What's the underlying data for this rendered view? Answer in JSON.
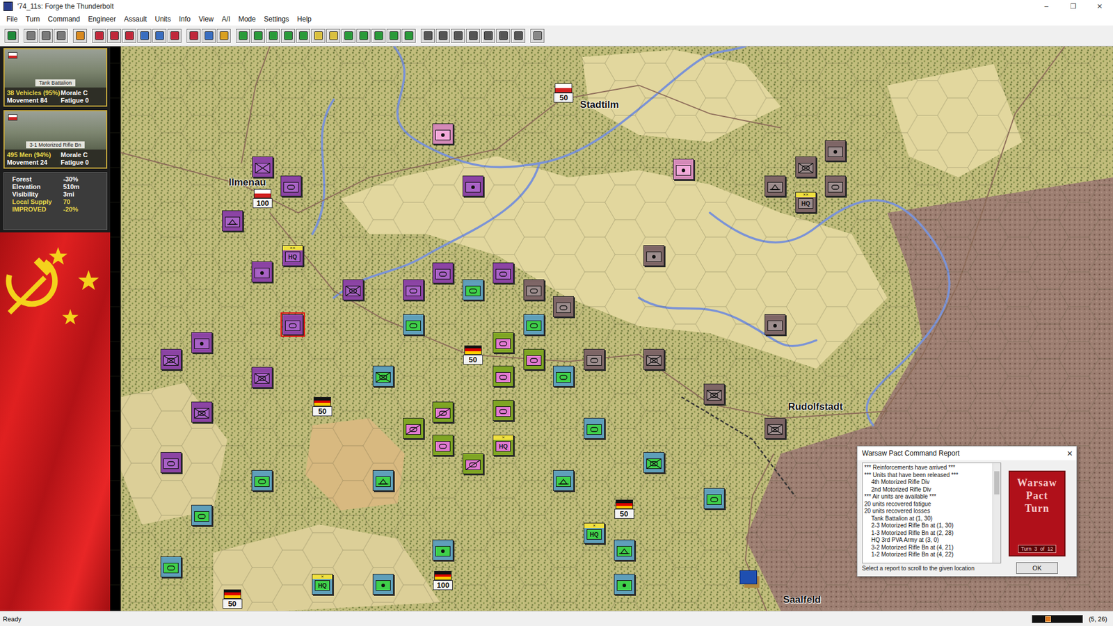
{
  "window": {
    "title": "'74_11s: Forge the Thunderbolt",
    "controls": [
      "–",
      "❐",
      "✕"
    ]
  },
  "menu": [
    "File",
    "Turn",
    "Command",
    "Engineer",
    "Assault",
    "Units",
    "Info",
    "View",
    "A/I",
    "Mode",
    "Settings",
    "Help"
  ],
  "toolbar": [
    {
      "buttons": [
        {
          "color": "#1f8a3a"
        }
      ]
    },
    {
      "buttons": [
        {
          "color": "#7a7a7a"
        },
        {
          "color": "#7a7a7a"
        },
        {
          "color": "#7a7a7a"
        }
      ]
    },
    {
      "buttons": [
        {
          "color": "#d98a20"
        }
      ]
    },
    {
      "buttons": [
        {
          "color": "#c0283a"
        },
        {
          "color": "#c0283a"
        },
        {
          "color": "#c0283a"
        },
        {
          "color": "#3a6ec0"
        },
        {
          "color": "#3a6ec0"
        },
        {
          "color": "#c0283a"
        }
      ]
    },
    {
      "buttons": [
        {
          "color": "#c0283a"
        },
        {
          "color": "#3a6ec0"
        },
        {
          "color": "#d9a020"
        }
      ]
    },
    {
      "buttons": [
        {
          "color": "#2a9a3a"
        },
        {
          "color": "#2a9a3a"
        },
        {
          "color": "#2a9a3a"
        },
        {
          "color": "#2a9a3a"
        },
        {
          "color": "#2a9a3a"
        },
        {
          "color": "#d9c040"
        },
        {
          "color": "#d9c040"
        },
        {
          "color": "#2a9a3a"
        },
        {
          "color": "#2a9a3a"
        },
        {
          "color": "#2a9a3a"
        },
        {
          "color": "#2a9a3a"
        },
        {
          "color": "#2a9a3a"
        }
      ]
    },
    {
      "buttons": [
        {
          "color": "#555555"
        },
        {
          "color": "#555555"
        },
        {
          "color": "#555555"
        },
        {
          "color": "#555555"
        },
        {
          "color": "#555555"
        },
        {
          "color": "#555555"
        },
        {
          "color": "#555555"
        }
      ]
    },
    {
      "buttons": [
        {
          "color": "#888888"
        }
      ]
    }
  ],
  "sidebar": {
    "units": [
      {
        "photo_label": "Tank Battalion",
        "stats": [
          {
            "text": "38 Vehicles (95%)",
            "highlight": true
          },
          {
            "text": "Morale C",
            "highlight": false
          },
          {
            "text": "Movement 84",
            "highlight": false
          },
          {
            "text": "Fatigue 0",
            "highlight": false
          }
        ]
      },
      {
        "photo_label": "3-1 Motorized Rifle Bn",
        "stats": [
          {
            "text": "495 Men (94%)",
            "highlight": true
          },
          {
            "text": "Morale C",
            "highlight": false
          },
          {
            "text": "Movement 24",
            "highlight": false
          },
          {
            "text": "Fatigue 0",
            "highlight": false
          }
        ]
      }
    ],
    "terrain": [
      {
        "label": "Forest",
        "value": "-30%",
        "highlight": false
      },
      {
        "label": "Elevation",
        "value": "510m",
        "highlight": false
      },
      {
        "label": "Visibility",
        "value": "3mi",
        "highlight": false
      },
      {
        "label": "Local Supply",
        "value": "70",
        "highlight": true
      },
      {
        "label": "IMPROVED",
        "value": "-20%",
        "highlight": true
      }
    ]
  },
  "map": {
    "cities": [
      {
        "name": "Stadtilm"
      },
      {
        "name": "Ilmenau"
      },
      {
        "name": "Rudolfstadt"
      },
      {
        "name": "Saalfeld"
      }
    ],
    "objectives": [
      {
        "value": "50",
        "flag": [
          "#ffffff",
          "#d22020"
        ]
      },
      {
        "value": "100",
        "flag": [
          "#ffffff",
          "#d22020"
        ]
      },
      {
        "value": "50",
        "flag": [
          "#111111",
          "#dd0000",
          "#ffcc00"
        ]
      },
      {
        "value": "50",
        "flag": [
          "#111111",
          "#dd0000",
          "#ffcc00"
        ]
      },
      {
        "value": "50",
        "flag": [
          "#111111",
          "#dd0000",
          "#ffcc00"
        ]
      },
      {
        "value": "100",
        "flag": [
          "#111111",
          "#dd0000",
          "#ffcc00"
        ]
      },
      {
        "value": "50",
        "flag": [
          "#111111",
          "#dd0000",
          "#ffcc00"
        ]
      }
    ],
    "units": [
      {
        "kind": "infantry",
        "color": "#8c44a4",
        "face": "#a962c6",
        "selected": false
      },
      {
        "kind": "armor",
        "color": "#8c44a4",
        "face": "#a962c6",
        "selected": false
      },
      {
        "kind": "engineer",
        "color": "#8c44a4",
        "face": "#a962c6",
        "selected": false
      },
      {
        "kind": "hq",
        "label": "HQ",
        "echelon": "××",
        "color": "#8c44a4",
        "face": "#a962c6",
        "selected": false
      },
      {
        "kind": "artillery",
        "color": "#8c44a4",
        "face": "#a962c6",
        "selected": false
      },
      {
        "kind": "mech",
        "color": "#8c44a4",
        "face": "#a962c6",
        "selected": false
      },
      {
        "kind": "armor",
        "color": "#8c44a4",
        "face": "#a962c6",
        "selected": false
      },
      {
        "kind": "armor",
        "color": "#8c44a4",
        "face": "#a962c6",
        "selected": false
      },
      {
        "kind": "armor",
        "color": "#8c44a4",
        "face": "#a962c6",
        "selected": false
      },
      {
        "kind": "armor",
        "color": "#8c44a4",
        "face": "#a962c6",
        "selected": true
      },
      {
        "kind": "artillery",
        "color": "#8c44a4",
        "face": "#a962c6",
        "selected": false
      },
      {
        "kind": "mech",
        "color": "#8c44a4",
        "face": "#a962c6",
        "selected": false
      },
      {
        "kind": "mech",
        "color": "#8c44a4",
        "face": "#a962c6",
        "selected": false
      },
      {
        "kind": "mech",
        "color": "#8c44a4",
        "face": "#a962c6",
        "selected": false
      },
      {
        "kind": "armor",
        "color": "#8c44a4",
        "face": "#a962c6",
        "selected": false
      },
      {
        "kind": "artillery",
        "color": "#8c44a4",
        "face": "#a962c6",
        "selected": false
      },
      {
        "kind": "artillery",
        "color": "#d48ab8",
        "face": "#f3a9d9",
        "selected": false
      },
      {
        "kind": "artillery",
        "color": "#d48ab8",
        "face": "#f3a9d9",
        "selected": false
      },
      {
        "kind": "artillery",
        "color": "#7e6666",
        "face": "#9d8d8d",
        "selected": false
      },
      {
        "kind": "mech",
        "color": "#7e6666",
        "face": "#9d8d8d",
        "selected": false
      },
      {
        "kind": "engineer",
        "color": "#7e6666",
        "face": "#9d8d8d",
        "selected": false
      },
      {
        "kind": "armor",
        "color": "#7e6666",
        "face": "#9d8d8d",
        "selected": false
      },
      {
        "kind": "hq",
        "label": "HQ",
        "echelon": "××",
        "color": "#7e6666",
        "face": "#9d8d8d",
        "selected": false
      },
      {
        "kind": "artillery",
        "color": "#7e6666",
        "face": "#9d8d8d",
        "selected": false
      },
      {
        "kind": "armor",
        "color": "#7e6666",
        "face": "#9d8d8d",
        "selected": false
      },
      {
        "kind": "armor",
        "color": "#7e6666",
        "face": "#9d8d8d",
        "selected": false
      },
      {
        "kind": "artillery",
        "color": "#7e6666",
        "face": "#9d8d8d",
        "selected": false
      },
      {
        "kind": "armor",
        "color": "#7e6666",
        "face": "#9d8d8d",
        "selected": false
      },
      {
        "kind": "mech",
        "color": "#7e6666",
        "face": "#9d8d8d",
        "selected": false
      },
      {
        "kind": "mech",
        "color": "#7e6666",
        "face": "#9d8d8d",
        "selected": false
      },
      {
        "kind": "mech",
        "color": "#7e6666",
        "face": "#9d8d8d",
        "selected": false
      },
      {
        "kind": "armor",
        "color": "#5f9fba",
        "face": "#3fd04a",
        "selected": false
      },
      {
        "kind": "armor",
        "color": "#5f9fba",
        "face": "#3fd04a",
        "selected": false
      },
      {
        "kind": "armor",
        "color": "#5f9fba",
        "face": "#3fd04a",
        "selected": false
      },
      {
        "kind": "armor",
        "color": "#5f9fba",
        "face": "#3fd04a",
        "selected": false
      },
      {
        "kind": "mech",
        "color": "#5f9fba",
        "face": "#3fd04a",
        "selected": false
      },
      {
        "kind": "armor",
        "color": "#5f9fba",
        "face": "#3fd04a",
        "selected": false
      },
      {
        "kind": "mech",
        "color": "#5f9fba",
        "face": "#3fd04a",
        "selected": false
      },
      {
        "kind": "engineer",
        "color": "#5f9fba",
        "face": "#3fd04a",
        "selected": false
      },
      {
        "kind": "engineer",
        "color": "#5f9fba",
        "face": "#3fd04a",
        "selected": false
      },
      {
        "kind": "armor",
        "color": "#5f9fba",
        "face": "#3fd04a",
        "selected": false
      },
      {
        "kind": "armor",
        "color": "#5f9fba",
        "face": "#3fd04a",
        "selected": false
      },
      {
        "kind": "armor",
        "color": "#5f9fba",
        "face": "#3fd04a",
        "selected": false
      },
      {
        "kind": "hq",
        "label": "HQ",
        "echelon": "×",
        "color": "#5f9fba",
        "face": "#3fd04a",
        "selected": false
      },
      {
        "kind": "engineer",
        "color": "#5f9fba",
        "face": "#3fd04a",
        "selected": false
      },
      {
        "kind": "armor",
        "color": "#5f9fba",
        "face": "#3fd04a",
        "selected": false
      },
      {
        "kind": "artillery",
        "color": "#5f9fba",
        "face": "#3fd04a",
        "selected": false
      },
      {
        "kind": "hq",
        "label": "HQ",
        "echelon": "×",
        "color": "#5f9fba",
        "face": "#3fd04a",
        "selected": false
      },
      {
        "kind": "artillery",
        "color": "#5f9fba",
        "face": "#3fd04a",
        "selected": false
      },
      {
        "kind": "artillery",
        "color": "#5f9fba",
        "face": "#3fd04a",
        "selected": false
      },
      {
        "kind": "armor",
        "color": "#7fa524",
        "face": "#e27ad2",
        "selected": false
      },
      {
        "kind": "armor",
        "color": "#7fa524",
        "face": "#e27ad2",
        "selected": false
      },
      {
        "kind": "armor",
        "color": "#7fa524",
        "face": "#e27ad2",
        "selected": false
      },
      {
        "kind": "armor",
        "color": "#7fa524",
        "face": "#e27ad2",
        "selected": false
      },
      {
        "kind": "recon",
        "color": "#7fa524",
        "face": "#e27ad2",
        "selected": false
      },
      {
        "kind": "recon",
        "color": "#7fa524",
        "face": "#e27ad2",
        "selected": false
      },
      {
        "kind": "armor",
        "color": "#7fa524",
        "face": "#e27ad2",
        "selected": false
      },
      {
        "kind": "recon",
        "color": "#7fa524",
        "face": "#e27ad2",
        "selected": false
      },
      {
        "kind": "hq",
        "label": "HQ",
        "echelon": "×",
        "color": "#7fa524",
        "face": "#e27ad2",
        "selected": false
      }
    ]
  },
  "dialog": {
    "title": "Warsaw Pact Command Report",
    "close": "✕",
    "lines": [
      {
        "text": "*** Reinforcements have arrived ***",
        "indent": false
      },
      {
        "text": "*** Units that have been released ***",
        "indent": false
      },
      {
        "text": "4th Motorized Rifle Div",
        "indent": true
      },
      {
        "text": "2nd Motorized Rifle Div",
        "indent": true
      },
      {
        "text": "*** Air units are available ***",
        "indent": false
      },
      {
        "text": "20 units recovered fatigue",
        "indent": false
      },
      {
        "text": "20 units recovered losses",
        "indent": false
      },
      {
        "text": "Tank Battalion at (1, 30)",
        "indent": true
      },
      {
        "text": "2-3 Motorized Rifle Bn at (1, 30)",
        "indent": true
      },
      {
        "text": "1-3 Motorized Rifle Bn at (2, 28)",
        "indent": true
      },
      {
        "text": "HQ 3rd PVA Army at (3, 0)",
        "indent": true
      },
      {
        "text": "3-2 Motorized Rifle Bn at (4, 21)",
        "indent": true
      },
      {
        "text": "1-2 Motorized Rifle Bn at (4, 22)",
        "indent": true
      }
    ],
    "footer": "Select a report to scroll to the given location",
    "banner": "Warsaw Pact Turn",
    "turn": "Turn  3  of  12",
    "button": "OK"
  },
  "status_bar": {
    "text": "Ready",
    "coords": "(5, 26)",
    "level": 0.25
  }
}
